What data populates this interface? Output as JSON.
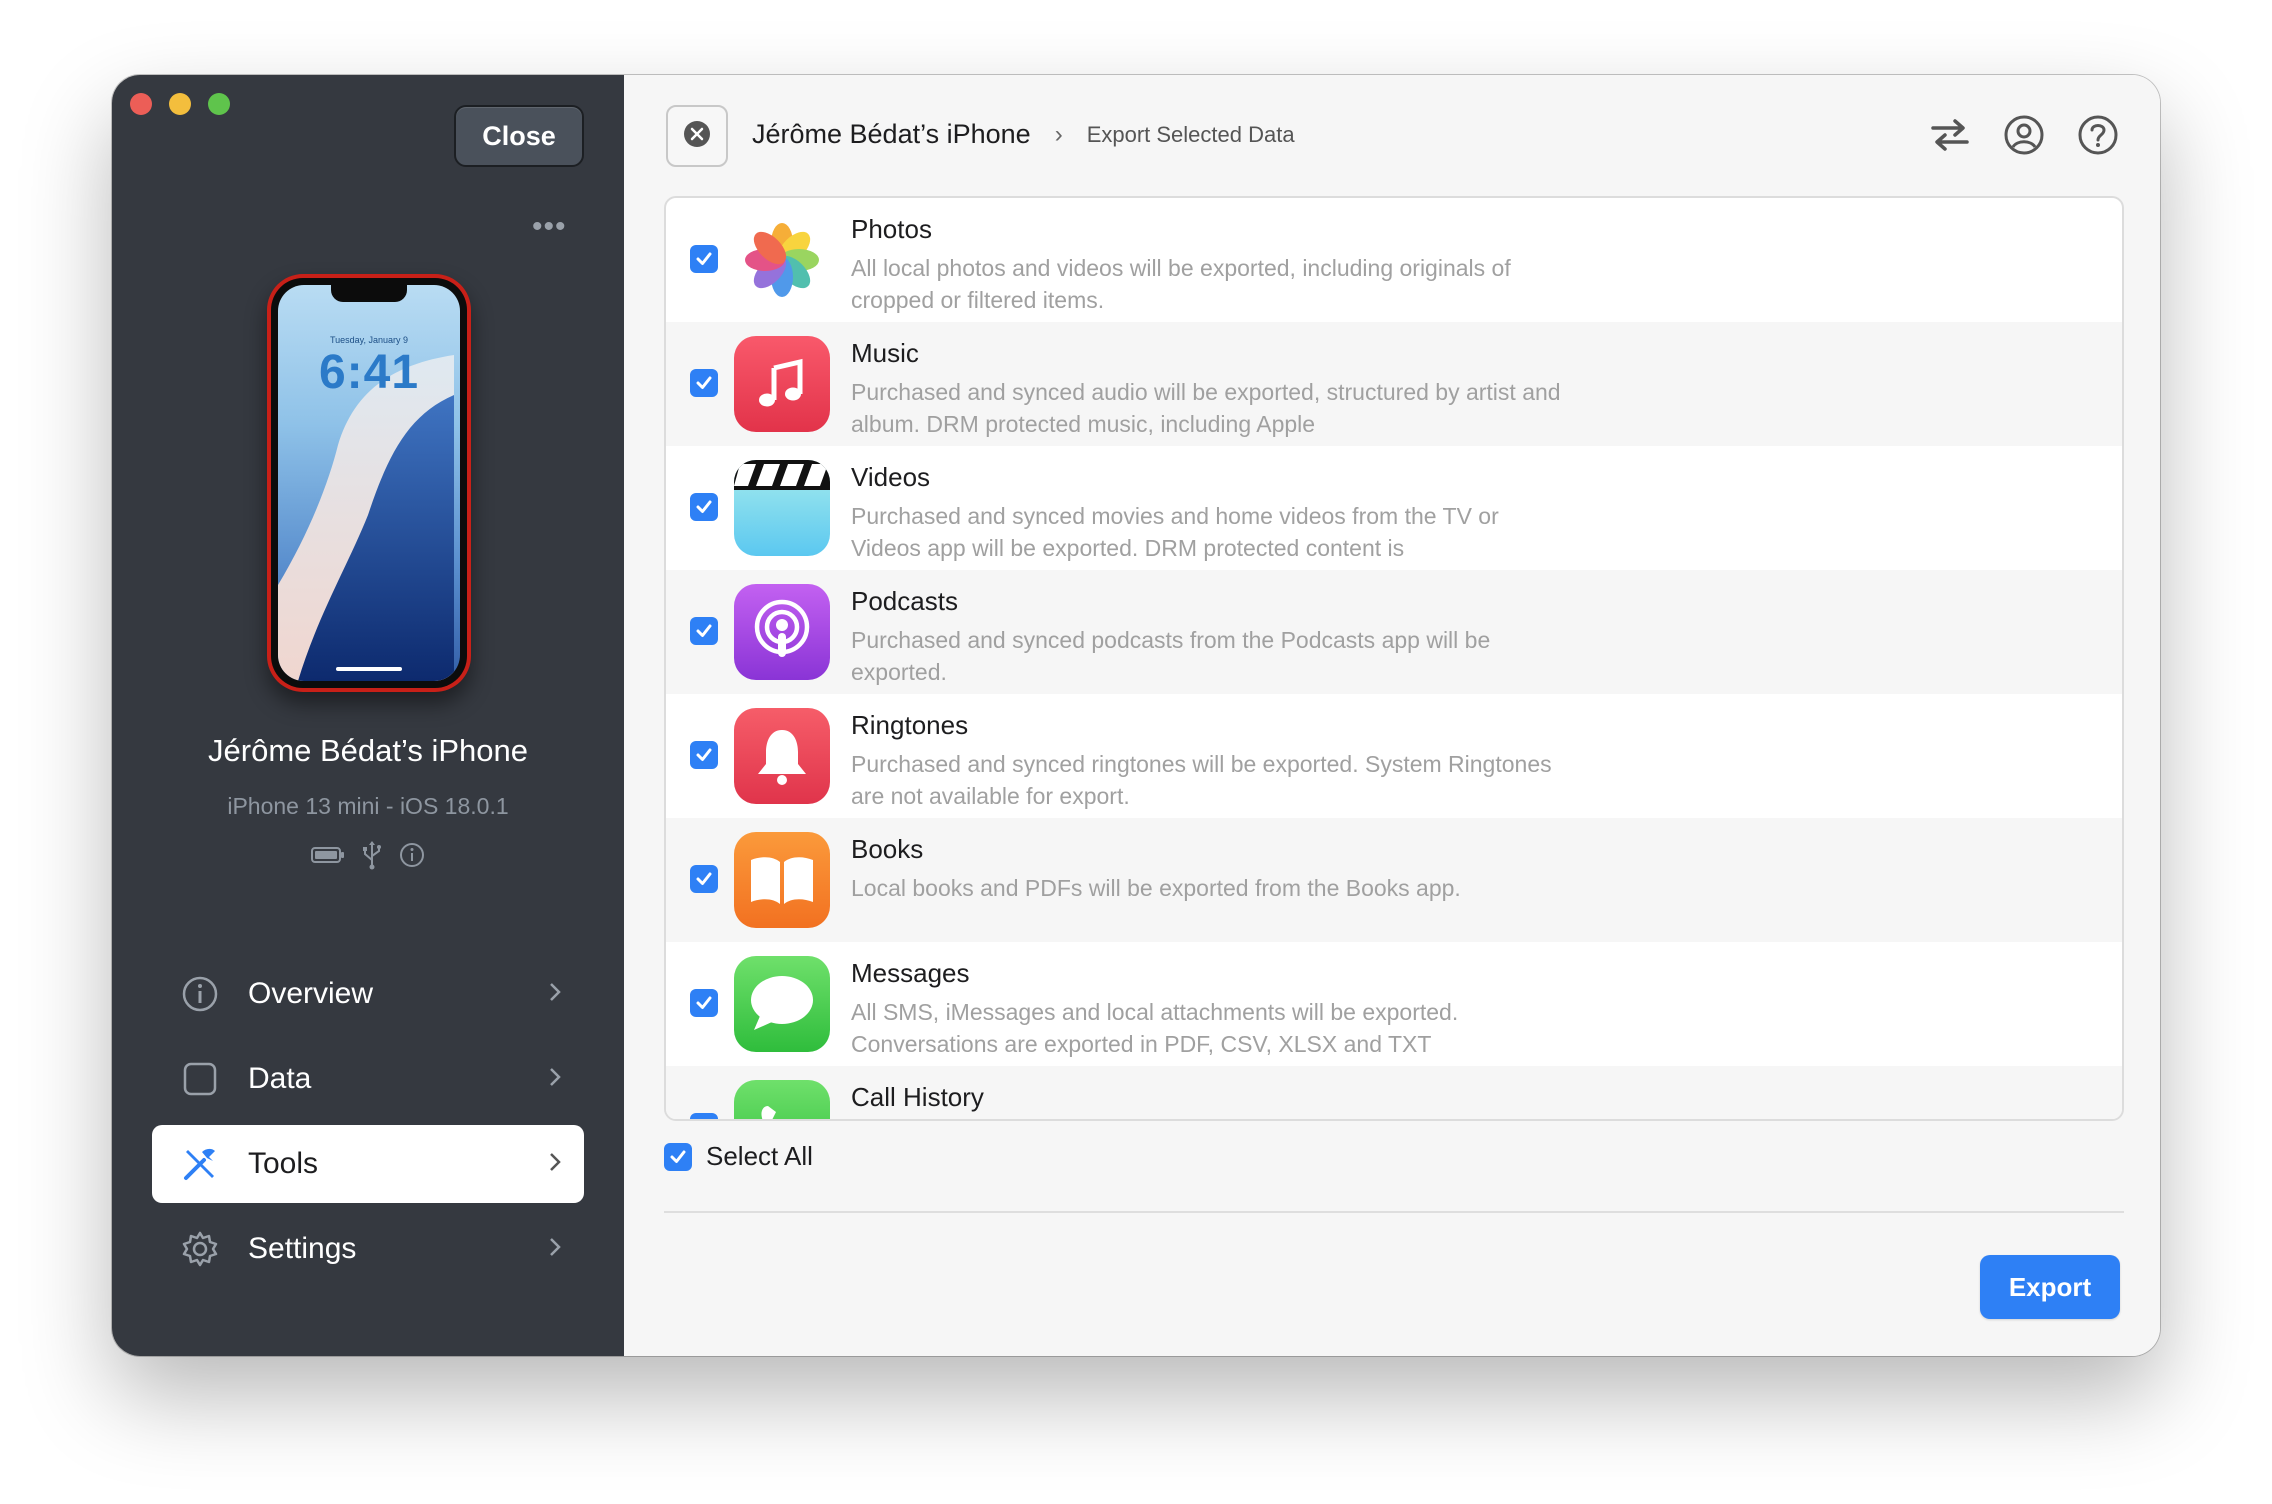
{
  "window": {
    "close_label": "Close",
    "more_label": "•••"
  },
  "device": {
    "name": "Jérôme Bédat’s iPhone",
    "model": "iPhone 13 mini - iOS 18.0.1",
    "lock_date": "Tuesday, January 9",
    "lock_time": "6:41"
  },
  "nav": {
    "items": [
      {
        "label": "Overview",
        "icon": "info-icon"
      },
      {
        "label": "Data",
        "icon": "square-icon"
      },
      {
        "label": "Tools",
        "icon": "tools-icon",
        "active": true
      },
      {
        "label": "Settings",
        "icon": "gear-icon"
      }
    ]
  },
  "breadcrumb": {
    "device": "Jérôme Bédat’s iPhone",
    "separator": "›",
    "page": "Export Selected Data"
  },
  "colors": {
    "accent": "#2e80f5",
    "sidebar": "#353940",
    "close_red": "#ec5e57",
    "min_yellow": "#f3be3d",
    "max_green": "#5fc44c"
  },
  "items": [
    {
      "title": "Photos",
      "desc": "All local photos and videos will be exported, including originals of cropped or filtered items.",
      "icon": "photos-icon",
      "checked": true
    },
    {
      "title": "Music",
      "desc": "Purchased and synced audio will be exported, structured by artist and album. DRM protected music, including Apple",
      "icon": "music-icon",
      "checked": true
    },
    {
      "title": "Videos",
      "desc": "Purchased and synced movies and home videos from the TV or Videos app will be exported. DRM protected content is",
      "icon": "videos-icon",
      "checked": true
    },
    {
      "title": "Podcasts",
      "desc": "Purchased and synced podcasts from the Podcasts app will be exported.",
      "icon": "podcasts-icon",
      "checked": true
    },
    {
      "title": "Ringtones",
      "desc": "Purchased and synced ringtones will be exported. System Ringtones are not available for export.",
      "icon": "ringtones-icon",
      "checked": true
    },
    {
      "title": "Books",
      "desc": "Local books and PDFs will be exported from the Books app.",
      "icon": "books-icon",
      "checked": true
    },
    {
      "title": "Messages",
      "desc": "All SMS, iMessages and local attachments will be exported. Conversations are exported in PDF, CSV, XLSX and TXT",
      "icon": "messages-icon",
      "checked": true
    },
    {
      "title": "Call History",
      "desc": "",
      "icon": "phone-icon",
      "checked": true
    }
  ],
  "select_all_label": "Select All",
  "export_label": "Export"
}
